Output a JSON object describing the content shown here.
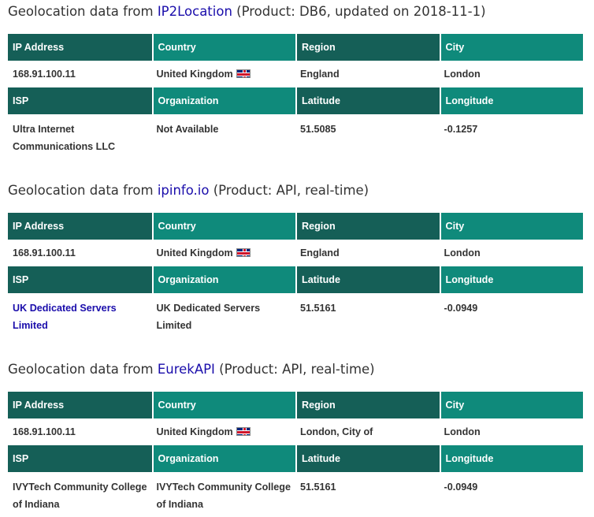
{
  "sections": [
    {
      "heading": {
        "prefix": "Geolocation data from ",
        "link": "IP2Location",
        "suffix": " (Product: DB6, updated on 2018-11-1)"
      },
      "labels": {
        "ip": "IP Address",
        "country": "Country",
        "region": "Region",
        "city": "City",
        "isp": "ISP",
        "organization": "Organization",
        "latitude": "Latitude",
        "longitude": "Longitude"
      },
      "ip": "168.91.100.11",
      "country": "United Kingdom",
      "country_flag_icon": "uk-flag-icon",
      "region": "England",
      "city": "London",
      "isp": "Ultra Internet Communications LLC",
      "organization": "Not Available",
      "latitude": "51.5085",
      "longitude": "-0.1257"
    },
    {
      "heading": {
        "prefix": "Geolocation data from ",
        "link": "ipinfo.io",
        "suffix": " (Product: API, real-time)"
      },
      "labels": {
        "ip": "IP Address",
        "country": "Country",
        "region": "Region",
        "city": "City",
        "isp": "ISP",
        "organization": "Organization",
        "latitude": "Latitude",
        "longitude": "Longitude"
      },
      "ip": "168.91.100.11",
      "country": "United Kingdom",
      "country_flag_icon": "uk-flag-icon",
      "region": "England",
      "city": "London",
      "isp": "UK Dedicated Servers Limited",
      "organization": "UK Dedicated Servers Limited",
      "latitude": "51.5161",
      "longitude": "-0.0949"
    },
    {
      "heading": {
        "prefix": "Geolocation data from ",
        "link": "EurekAPI",
        "suffix": " (Product: API, real-time)"
      },
      "labels": {
        "ip": "IP Address",
        "country": "Country",
        "region": "Region",
        "city": "City",
        "isp": "ISP",
        "organization": "Organization",
        "latitude": "Latitude",
        "longitude": "Longitude"
      },
      "ip": "168.91.100.11",
      "country": "United Kingdom",
      "country_flag_icon": "uk-flag-icon",
      "region": "London, City of",
      "city": "London",
      "isp": "IVYTech Community College of Indiana",
      "organization": "IVYTech Community College of Indiana",
      "latitude": "51.5161",
      "longitude": "-0.0949"
    }
  ],
  "colors": {
    "header_dark": "#155f57",
    "header_light": "#0f8a7b",
    "link": "#1a0dab",
    "text": "#333333"
  }
}
